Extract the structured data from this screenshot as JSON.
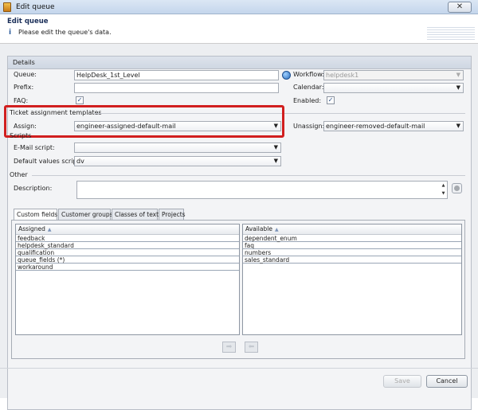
{
  "window": {
    "title": "Edit queue",
    "close_glyph": "✕"
  },
  "header": {
    "title": "Edit queue",
    "subtitle": "Please edit the queue's data.",
    "info_glyph": "i"
  },
  "details": {
    "section_title": "Details",
    "queue": {
      "label": "Queue:",
      "value": "HelpDesk_1st_Level"
    },
    "prefix": {
      "label": "Prefix:",
      "value": ""
    },
    "faq": {
      "label": "FAQ:",
      "checked": true
    },
    "workflow": {
      "label": "Workflow:",
      "value": "helpdesk1"
    },
    "calendar": {
      "label": "Calendar:",
      "value": ""
    },
    "enabled": {
      "label": "Enabled:",
      "checked": true
    }
  },
  "ticket_templates": {
    "section_title": "Ticket assignment templates",
    "assign": {
      "label": "Assign:",
      "value": "engineer-assigned-default-mail"
    },
    "unassign": {
      "label": "Unassign:",
      "value": "engineer-removed-default-mail"
    }
  },
  "scripts": {
    "section_title": "Scripts",
    "email": {
      "label": "E-Mail script:",
      "value": ""
    },
    "default_values": {
      "label": "Default values script:",
      "value": "dv"
    }
  },
  "other": {
    "section_title": "Other",
    "description": {
      "label": "Description:",
      "value": ""
    }
  },
  "tabs": [
    "Custom fields",
    "Customer groups",
    "Classes of text",
    "Projects"
  ],
  "assigned": {
    "header": "Assigned",
    "items": [
      "feedback",
      "helpdesk_standard",
      "qualification",
      "queue_fields (*)",
      "workaround"
    ]
  },
  "available": {
    "header": "Available",
    "items": [
      "dependent_enum",
      "faq",
      "numbers",
      "sales_standard"
    ]
  },
  "buttons": {
    "save": "Save",
    "cancel": "Cancel"
  },
  "glyphs": {
    "check": "✓",
    "dropdown": "▼",
    "sort": "▲",
    "spin_up": "▲",
    "spin_down": "▼",
    "move_right": "➡",
    "move_left": "⬅"
  }
}
